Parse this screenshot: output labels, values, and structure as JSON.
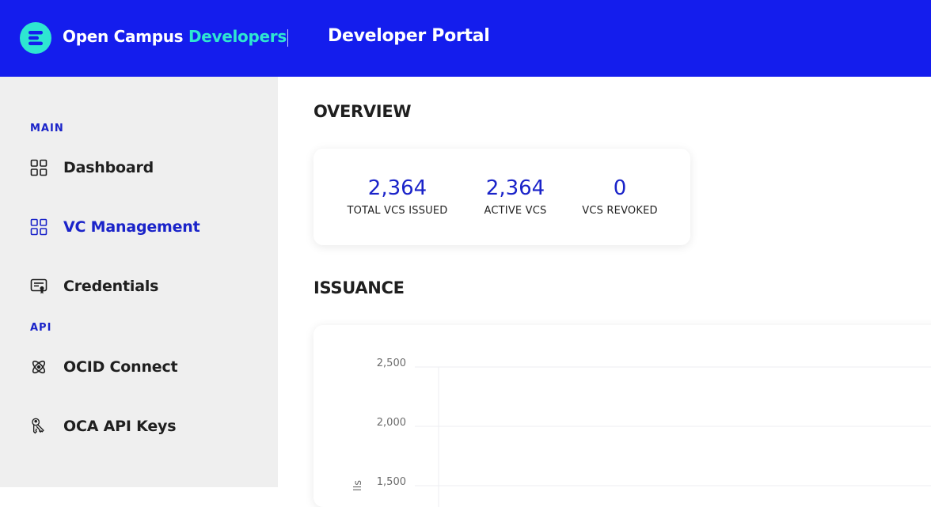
{
  "header": {
    "brand_primary": "Open Campus",
    "brand_accent": "Developers",
    "portal_title": "Developer Portal",
    "colors": {
      "bar": "#141ded",
      "accent": "#2ee6d1"
    }
  },
  "sidebar": {
    "sections": [
      {
        "label": "MAIN"
      },
      {
        "label": "API"
      }
    ],
    "items": [
      {
        "label": "Dashboard",
        "icon": "grid-icon",
        "active": false
      },
      {
        "label": "VC Management",
        "icon": "grid-icon",
        "active": true
      },
      {
        "label": "Credentials",
        "icon": "certificate-icon",
        "active": false
      },
      {
        "label": "OCID Connect",
        "icon": "atom-icon",
        "active": false
      },
      {
        "label": "OCA API Keys",
        "icon": "keys-icon",
        "active": false
      }
    ]
  },
  "main": {
    "overview_heading": "OVERVIEW",
    "issuance_heading": "ISSUANCE",
    "stats": [
      {
        "value": "2,364",
        "caption": "TOTAL VCS ISSUED"
      },
      {
        "value": "2,364",
        "caption": "ACTIVE VCS"
      },
      {
        "value": "0",
        "caption": "VCS REVOKED"
      }
    ]
  },
  "chart_data": {
    "type": "line",
    "title": "",
    "ylabel": "lls",
    "yticks": [
      "2,500",
      "2,000",
      "1,500"
    ],
    "ylim": [
      1500,
      2500
    ],
    "grid": true
  }
}
